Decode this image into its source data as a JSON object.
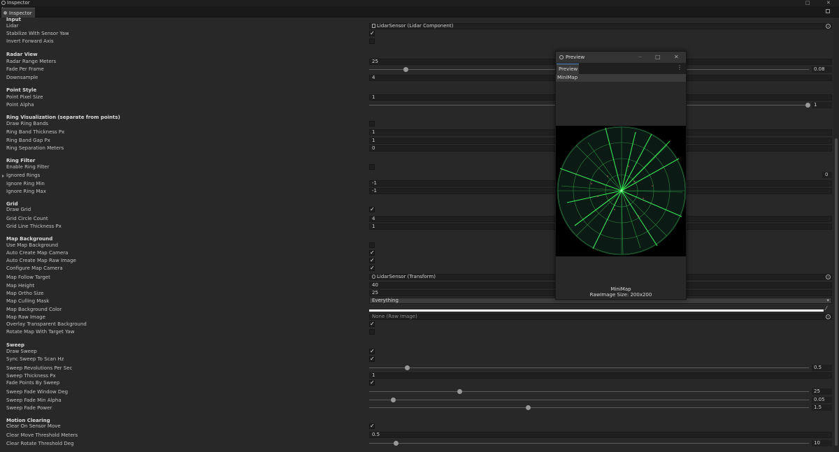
{
  "window": {
    "title": "Inspector",
    "tab": "Inspector"
  },
  "sections": {
    "input": {
      "header": "Input",
      "lidar": "Lidar",
      "stabilize": "Stabilize With Sensor Yaw",
      "invert": "Invert Forward Axis",
      "lidar_value": "LidarSensor (Lidar Component)"
    },
    "radar": {
      "header": "Radar View",
      "range": "Radar Range Meters",
      "range_value": "25",
      "fade": "Fade Per Frame",
      "fade_value": "0.08",
      "downsample": "Downsample",
      "downsample_value": "4"
    },
    "point": {
      "header": "Point Style",
      "pixel": "Point Pixel Size",
      "pixel_value": "1",
      "alpha": "Point Alpha",
      "alpha_value": "1"
    },
    "ringvis": {
      "header": "Ring Visualization (separate from points)",
      "draw": "Draw Ring Bands",
      "thick": "Ring Band Thickness Px",
      "thick_value": "1",
      "gap": "Ring Band Gap Px",
      "gap_value": "1",
      "sep": "Ring Separation Meters",
      "sep_value": "0"
    },
    "ringfilter": {
      "header": "Ring Filter",
      "enable": "Enable Ring Filter",
      "ignored": "Ignored Rings",
      "ignored_count": "0",
      "min": "Ignore Ring Min",
      "min_value": "-1",
      "max": "Ignore Ring Max",
      "max_value": "-1"
    },
    "grid": {
      "header": "Grid",
      "draw": "Draw Grid",
      "count": "Grid Circle Count",
      "count_value": "4",
      "thick": "Grid Line Thickness Px",
      "thick_value": "1"
    },
    "map": {
      "header": "Map Background",
      "use": "Use Map Background",
      "camera": "Auto Create Map Camera",
      "raw": "Auto Create Map Raw Image",
      "config": "Configure Map Camera",
      "follow": "Map Follow Target",
      "follow_value": "LidarSensor (Transform)",
      "height": "Map Height",
      "height_value": "40",
      "ortho": "Map Ortho Size",
      "ortho_value": "25",
      "culling": "Map Culling Mask",
      "culling_value": "Everything",
      "color": "Map Background Color",
      "rawimg": "Map Raw Image",
      "rawimg_value": "None (Raw Image)",
      "overlay": "Overlay Transparent Background",
      "rotate": "Rotate Map With Target Yaw"
    },
    "sweep": {
      "header": "Sweep",
      "draw": "Draw Sweep",
      "sync": "Sync Sweep To Scan Hz",
      "rev": "Sweep Revolutions Per Sec",
      "rev_value": "0.5",
      "thick": "Sweep Thickness Px",
      "thick_value": "1",
      "fadepts": "Fade Points By Sweep",
      "window": "Sweep Fade Window Deg",
      "window_value": "25",
      "minalpha": "Sweep Fade Min Alpha",
      "minalpha_value": "0.05",
      "power": "Sweep Fade Power",
      "power_value": "1.5"
    },
    "motion": {
      "header": "Motion Clearing",
      "clear": "Clear On Sensor Move",
      "move": "Clear Move Threshold Meters",
      "move_value": "0.5",
      "rot": "Clear Rotate Threshold Deg",
      "rot_value": "10"
    }
  },
  "preview": {
    "title": "Preview",
    "tab": "Preview",
    "header": "MiniMap",
    "caption": "MiniMap",
    "size": "RawImage Size: 200x200"
  },
  "colors": {
    "background": "#282828",
    "field": "#1f1f1f",
    "radar_green": "#3cff5a"
  }
}
